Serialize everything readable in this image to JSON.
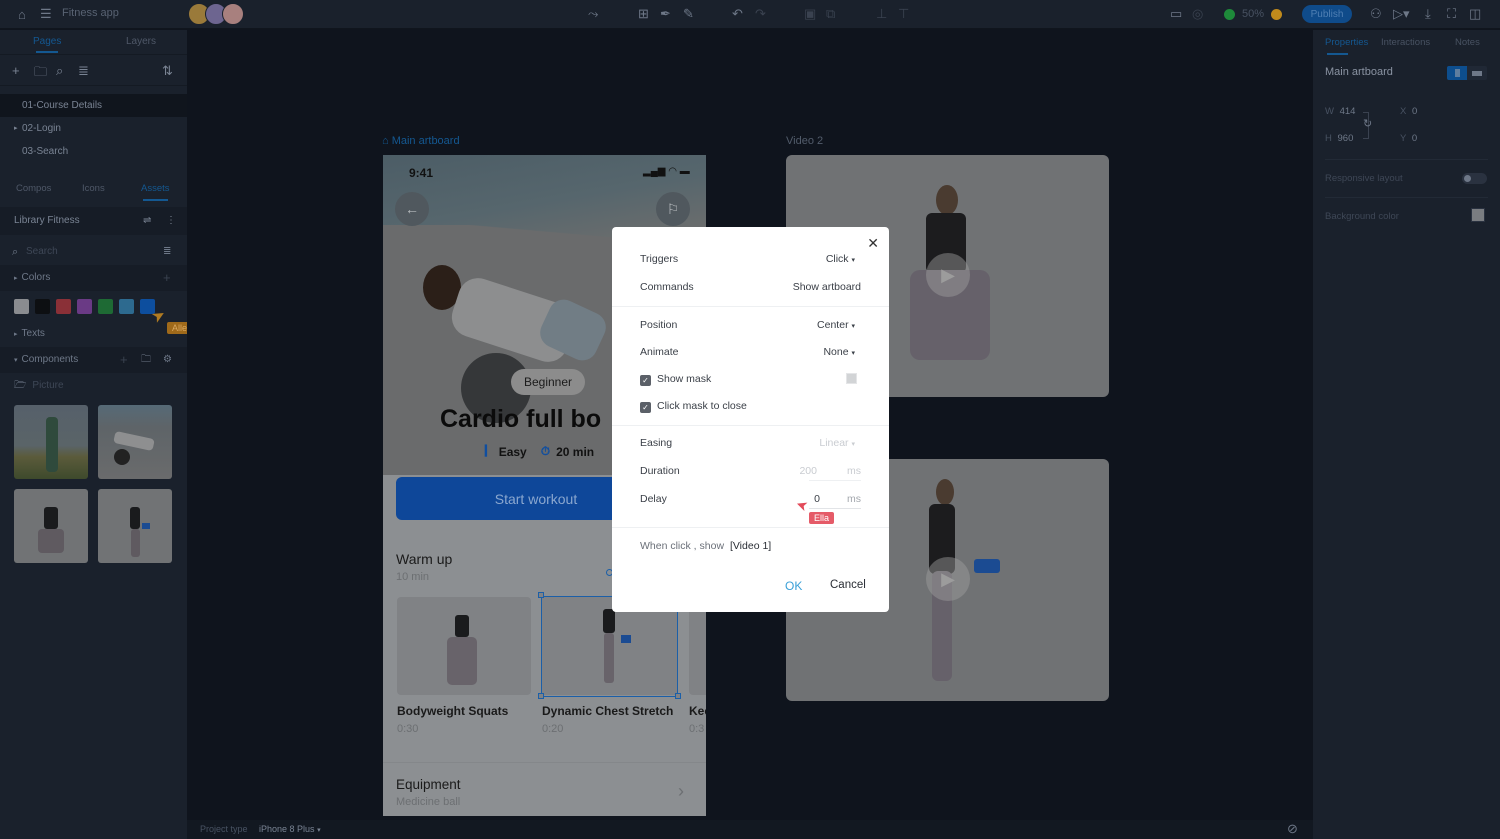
{
  "topbar": {
    "app_title": "Fitness app",
    "zoom_level": "50%",
    "publish_label": "Publish",
    "avatar_colors": [
      "#b78a2c",
      "#7a6fa2",
      "#c08f8a"
    ]
  },
  "left_panel": {
    "tabs": [
      "Pages",
      "Layers"
    ],
    "pages": [
      "01-Course Details",
      "02-Login",
      "03-Search"
    ],
    "asset_tabs": [
      "Compos",
      "Icons",
      "Assets"
    ],
    "library_name": "Library Fitness",
    "search_placeholder": "Search",
    "colors_label": "Colors",
    "swatches": [
      "#8a8c90",
      "#0d0f12",
      "#8a3037",
      "#6a3a85",
      "#1e6a34",
      "#2d6a8f",
      "#0d4e9e"
    ],
    "texts_label": "Texts",
    "components_label": "Components",
    "picture_label": "Picture",
    "cursor_user_allen": "Allen"
  },
  "canvas": {
    "main_artboard_label": "Main artboard",
    "video2_label": "Video 2",
    "phone": {
      "time": "9:41",
      "badge": "Beginner",
      "title": "Cardio full bo",
      "difficulty": "Easy",
      "duration": "20 min",
      "cta": "Start workout",
      "section_title": "Warm up",
      "section_sub": "10 min",
      "exercises": [
        {
          "name": "Bodyweight Squats",
          "time": "0:30"
        },
        {
          "name": "Dynamic Chest Stretch",
          "time": "0:20"
        },
        {
          "name": "Kee",
          "time": "0:3"
        }
      ],
      "equipment_title": "Equipment",
      "equipment_value": "Medicine ball"
    }
  },
  "dialog": {
    "triggers_label": "Triggers",
    "triggers_value": "Click",
    "commands_label": "Commands",
    "commands_value": "Show artboard",
    "position_label": "Position",
    "position_value": "Center",
    "animate_label": "Animate",
    "animate_value": "None",
    "show_mask_label": "Show mask",
    "click_mask_label": "Click mask to close",
    "easing_label": "Easing",
    "easing_value": "Linear",
    "duration_label": "Duration",
    "duration_value": "200",
    "delay_label": "Delay",
    "delay_value": "0",
    "unit": "ms",
    "summary_prefix": "When click , show",
    "summary_target": "[Video 1]",
    "ok_label": "OK",
    "cancel_label": "Cancel",
    "cursor_user_ella": "Ella"
  },
  "right_panel": {
    "tabs": [
      "Properties",
      "Interactions",
      "Notes"
    ],
    "artboard_name": "Main artboard",
    "w_label": "W",
    "w_value": "414",
    "h_label": "H",
    "h_value": "960",
    "x_label": "X",
    "x_value": "0",
    "y_label": "Y",
    "y_value": "0",
    "responsive_label": "Responsive layout",
    "bg_color_label": "Background color"
  },
  "statusbar": {
    "project_type_label": "Project type",
    "project_type_value": "iPhone 8 Plus"
  }
}
